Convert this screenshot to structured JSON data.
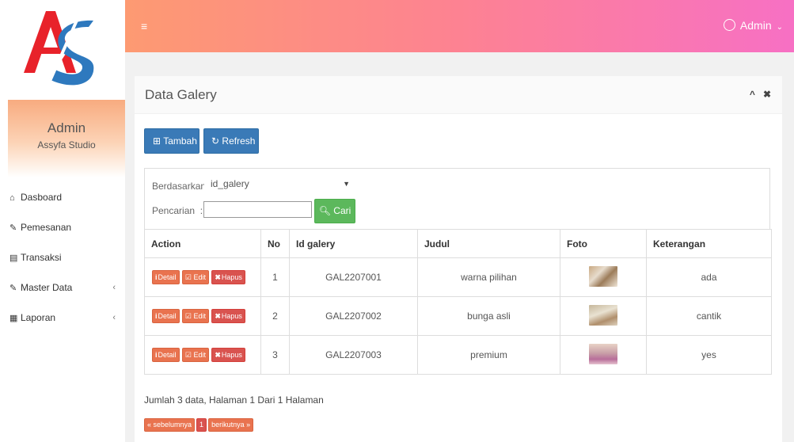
{
  "sidebar": {
    "logo_text": "AS",
    "profile_name": "Admin",
    "profile_subtitle": "Assyfa Studio",
    "items": [
      {
        "icon": "home-icon",
        "glyph": "⌂",
        "label": "Dasboard",
        "has_submenu": false
      },
      {
        "icon": "pencil-icon",
        "glyph": "✎",
        "label": "Pemesanan",
        "has_submenu": false
      },
      {
        "icon": "book-icon",
        "glyph": "▤",
        "label": "Transaksi",
        "has_submenu": false
      },
      {
        "icon": "edit-icon",
        "glyph": "✎",
        "label": "Master Data",
        "has_submenu": true
      },
      {
        "icon": "calendar-icon",
        "glyph": "▦",
        "label": "Laporan",
        "has_submenu": true
      }
    ]
  },
  "topbar": {
    "menu_icon": "≡",
    "user_label": "Admin"
  },
  "panel": {
    "title": "Data Galery",
    "buttons": {
      "tambah": "Tambah",
      "refresh": "Refresh"
    },
    "search": {
      "by_label": "Berdasarkan:",
      "by_value": "id_galery",
      "query_label": "Pencarian",
      "query_value": "",
      "cari_label": "Cari"
    },
    "table": {
      "headers": [
        "Action",
        "No",
        "Id galery",
        "Judul",
        "Foto",
        "Keterangan"
      ],
      "actions": {
        "detail": "Detail",
        "edit": "Edit",
        "hapus": "Hapus"
      },
      "rows": [
        {
          "no": "1",
          "id": "GAL2207001",
          "judul": "warna pilihan",
          "keterangan": "ada"
        },
        {
          "no": "2",
          "id": "GAL2207002",
          "judul": "bunga asli",
          "keterangan": "cantik"
        },
        {
          "no": "3",
          "id": "GAL2207003",
          "judul": "premium",
          "keterangan": "yes"
        }
      ]
    },
    "summary": "Jumlah 3 data, Halaman 1 Dari 1 Halaman",
    "pager": {
      "prev": "« sebelumnya",
      "page": "1",
      "next": "berikutnya »"
    }
  },
  "colors": {
    "topbar_start": "#fd9a72",
    "topbar_end": "#f770c4",
    "primary": "#3a7ab7",
    "success": "#5cb85c",
    "danger": "#d9534f"
  }
}
